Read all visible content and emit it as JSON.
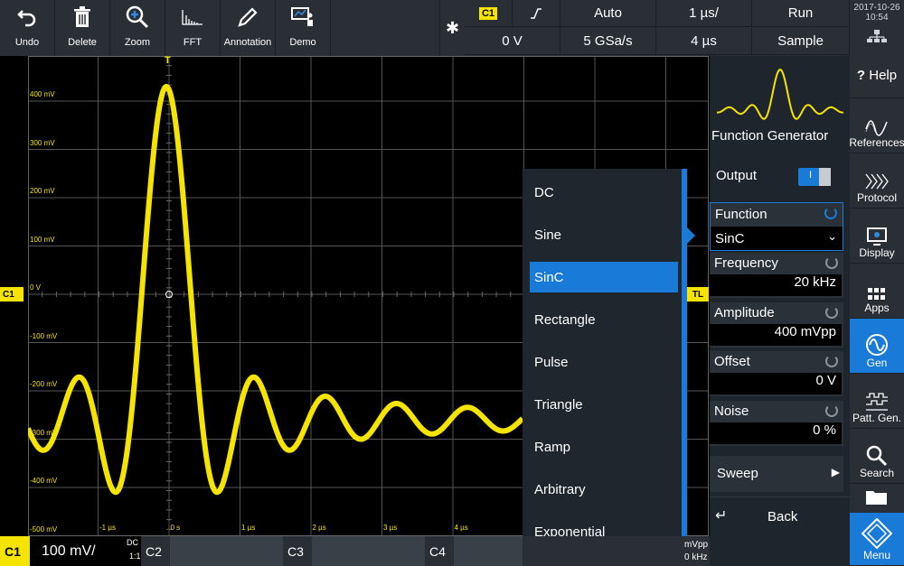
{
  "toolbar": {
    "undo": "Undo",
    "delete": "Delete",
    "zoom": "Zoom",
    "fft": "FFT",
    "annotation": "Annotation",
    "demo": "Demo"
  },
  "acquisition": {
    "source": "C1",
    "slope_icon": "rising-edge-icon",
    "mode": "Auto",
    "timebase": "1 µs/",
    "run": "Run",
    "level": "0 V",
    "rate": "5 GSa/s",
    "length": "4 µs",
    "acq_mode": "Sample"
  },
  "clock": {
    "date": "2017-10-26",
    "time": "10:54"
  },
  "waveform": {
    "trigger_marker": "T",
    "y_labels": [
      "400 mV",
      "300 mV",
      "200 mV",
      "100 mV",
      "0 V",
      "-100 mV",
      "-200 mV",
      "-300 mV",
      "-400 mV",
      "-500 mV"
    ],
    "x_labels": [
      "-1 µs",
      "0 s",
      "1 µs",
      "2 µs",
      "3 µs",
      "4 µs"
    ],
    "channel_marker": "C1",
    "tl_marker": "TL",
    "trace_color": "#f5e400"
  },
  "function_list": {
    "items": [
      "DC",
      "Sine",
      "SinC",
      "Rectangle",
      "Pulse",
      "Triangle",
      "Ramp",
      "Arbitrary",
      "Exponential"
    ],
    "selected": "SinC"
  },
  "generator": {
    "title": "Function Generator",
    "output_label": "Output",
    "output_toggle": "I",
    "function_label": "Function",
    "function_value": "SinC",
    "frequency_label": "Frequency",
    "frequency_value": "20 kHz",
    "amplitude_label": "Amplitude",
    "amplitude_value": "400 mVpp",
    "offset_label": "Offset",
    "offset_value": "0 V",
    "noise_label": "Noise",
    "noise_value": "0 %",
    "sweep_label": "Sweep",
    "back_label": "Back"
  },
  "sidebar": {
    "items": [
      "Help",
      "References",
      "Protocol",
      "Display",
      "Apps",
      "Gen",
      "Patt. Gen.",
      "Search",
      "Menu"
    ]
  },
  "bottom": {
    "c1": "C1",
    "c1_scale": "100 mV/",
    "c1_coupling": "DC",
    "c1_ratio": "1:1",
    "c2": "C2",
    "c3": "C3",
    "c4": "C4",
    "gen_amp": "mVpp",
    "gen_freq": "0 kHz"
  }
}
